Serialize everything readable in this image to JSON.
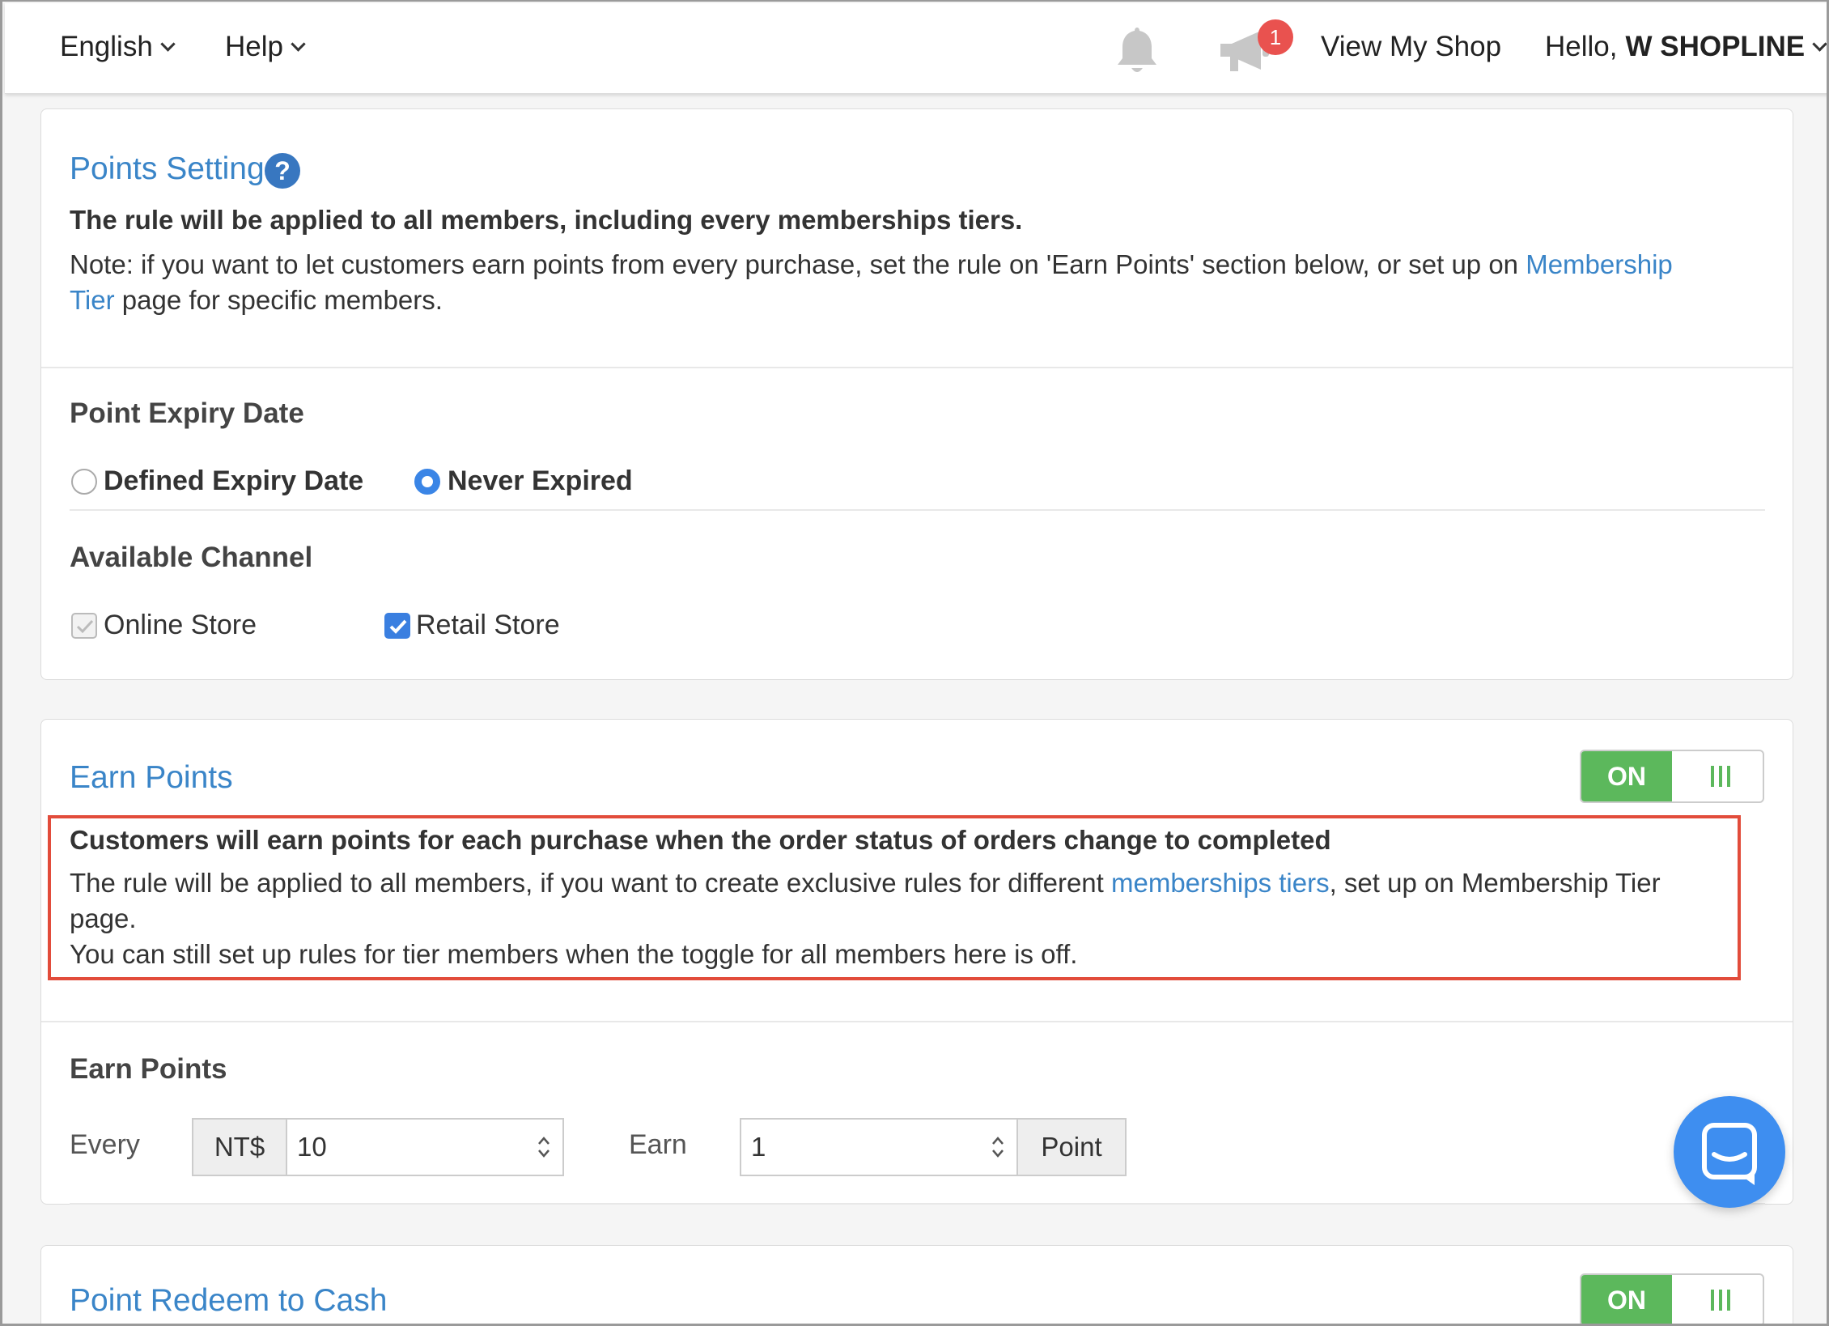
{
  "topbar": {
    "language": "English",
    "help": "Help",
    "notification_count": "1",
    "view_shop": "View My Shop",
    "greeting": "Hello,",
    "user": "W SHOPLINE"
  },
  "points_setting": {
    "title": "Points Setting",
    "rule_bold": "The rule will be applied to all members, including every memberships tiers.",
    "note_prefix": "Note: if you want to let customers earn points from every purchase, set the rule on 'Earn Points' section below, or set up on ",
    "note_link_1": "Membership",
    "note_link_2": "Tier",
    "note_suffix": " page for specific members.",
    "expiry_label": "Point Expiry Date",
    "expiry_options": [
      "Defined Expiry Date",
      "Never Expired"
    ],
    "expiry_selected": "Never Expired",
    "channel_label": "Available Channel",
    "channels": [
      "Online Store",
      "Retail Store"
    ]
  },
  "earn_points": {
    "title": "Earn Points",
    "toggle": "ON",
    "headline": "Customers will earn points for each purchase when the order status of orders change to completed",
    "desc_prefix": "The rule will be applied to all members, if you want to create exclusive rules for different ",
    "desc_link": "memberships tiers",
    "desc_suffix": ", set up on Membership Tier",
    "desc_line2": "page.",
    "desc_line3": "You can still set up rules for tier members when the toggle for all members here is off.",
    "section_label": "Earn Points",
    "every_label": "Every",
    "currency": "NT$",
    "amount": "10",
    "earn_label": "Earn",
    "points": "1",
    "point_unit": "Point"
  },
  "redeem": {
    "title": "Point Redeem to Cash",
    "toggle": "ON"
  },
  "colors": {
    "link": "#3a85c8",
    "toggle_on": "#5cb85c",
    "highlight": "#e24c3b",
    "badge": "#e9524f",
    "chat": "#3e8ef0"
  }
}
